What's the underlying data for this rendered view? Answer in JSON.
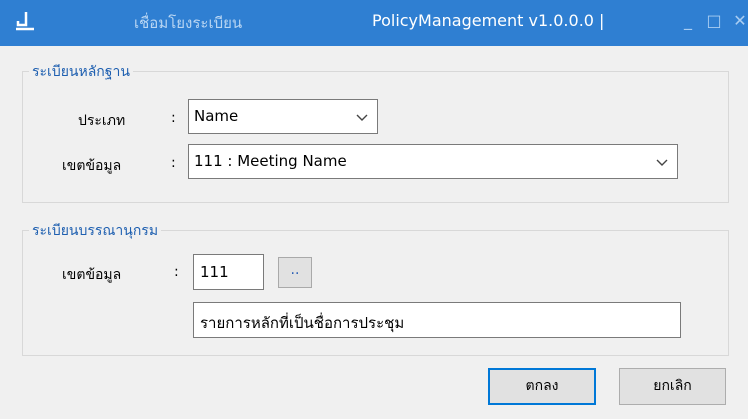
{
  "titlebar": {
    "window_title": "เชื่อมโยงระเบียน",
    "app_name": "PolicyManagement v1.0.0.0 |",
    "minimize_glyph": "_",
    "maximize_glyph": "□",
    "close_glyph": "✕",
    "color": "#2f7fd2"
  },
  "authority_group": {
    "legend": "ระเบียนหลักฐาน",
    "type_label": "ประเภท",
    "colon": ":",
    "type_value": "Name",
    "field_label": "เขตข้อมูล",
    "field_value": "111 : Meeting Name"
  },
  "catalog_group": {
    "legend": "ระเบียนบรรณานุกรม",
    "field_label": "เขตข้อมูล",
    "colon": ":",
    "field_code": "111",
    "browse_label": "..",
    "description": "รายการหลักที่เป็นชื่อการประชุม"
  },
  "buttons": {
    "ok_label": "ตกลง",
    "cancel_label": "ยกเลิก"
  }
}
